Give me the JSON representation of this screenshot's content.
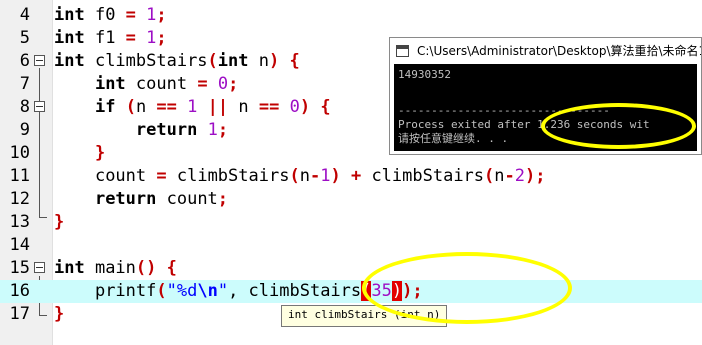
{
  "editor": {
    "line_numbers": [
      "4",
      "5",
      "6",
      "7",
      "8",
      "9",
      "10",
      "11",
      "12",
      "13",
      "14",
      "15",
      "16",
      "17"
    ],
    "lines": {
      "l4": {
        "t1": "int",
        "t2": " f0 ",
        "t3": "=",
        "t4": " ",
        "t5": "1",
        "t6": ";"
      },
      "l5": {
        "t1": "int",
        "t2": " f1 ",
        "t3": "=",
        "t4": " ",
        "t5": "1",
        "t6": ";"
      },
      "l6": {
        "t1": "int",
        "t2": " climbStairs",
        "t3": "(",
        "t4": "int",
        "t5": " n",
        "t6": ")",
        "t7": " ",
        "t8": "{"
      },
      "l7": {
        "t0": "    ",
        "t1": "int",
        "t2": " count ",
        "t3": "=",
        "t4": " ",
        "t5": "0",
        "t6": ";"
      },
      "l8": {
        "t0": "    ",
        "t1": "if",
        "t2": " ",
        "t3": "(",
        "t4": "n ",
        "t5": "==",
        "t6": " ",
        "t7": "1",
        "t8": " ",
        "t9": "||",
        "t10": " n ",
        "t11": "==",
        "t12": " ",
        "t13": "0",
        "t14": ")",
        "t15": " ",
        "t16": "{"
      },
      "l9": {
        "t0": "        ",
        "t1": "return",
        "t2": " ",
        "t3": "1",
        "t4": ";"
      },
      "l10": {
        "t0": "    ",
        "t1": "}"
      },
      "l11": {
        "t0": "    ",
        "t1": "count ",
        "t2": "=",
        "t3": " climbStairs",
        "t4": "(",
        "t5": "n",
        "t6": "-",
        "t7": "1",
        "t8": ")",
        "t9": " ",
        "t10": "+",
        "t11": " climbStairs",
        "t12": "(",
        "t13": "n",
        "t14": "-",
        "t15": "2",
        "t16": ")",
        "t17": ";"
      },
      "l12": {
        "t0": "    ",
        "t1": "return",
        "t2": " count",
        "t3": ";"
      },
      "l13": {
        "t1": "}"
      },
      "l15": {
        "t1": "int",
        "t2": " main",
        "t3": "()",
        "t4": " ",
        "t5": "{"
      },
      "l16": {
        "t0": "    ",
        "t1": "printf",
        "t2": "(",
        "t3": "\"%d",
        "t4": "\\n",
        "t5": "\"",
        "t6": ", climbStairs",
        "t7": "(",
        "t8": "35",
        "t9": ")",
        "t10": ")",
        "t11": ";"
      },
      "l17": {
        "t1": "}"
      }
    }
  },
  "console": {
    "title": "C:\\Users\\Administrator\\Desktop\\算法重拾\\未命名1",
    "output_value": "14930352",
    "separator": "--------------------------------",
    "exit_message": "Process exited after 1.236 seconds wit",
    "continue_prompt": "请按任意键继续. . ."
  },
  "tooltip": {
    "text": "int climbStairs (int n)"
  },
  "colors": {
    "keyword": "#000000",
    "number": "#9d0ec5",
    "operator": "#c00000",
    "string": "#0000ff",
    "active_line": "#ccfcfc",
    "highlight_ellipse": "#ffff00",
    "bracket_match": "#e30000"
  }
}
